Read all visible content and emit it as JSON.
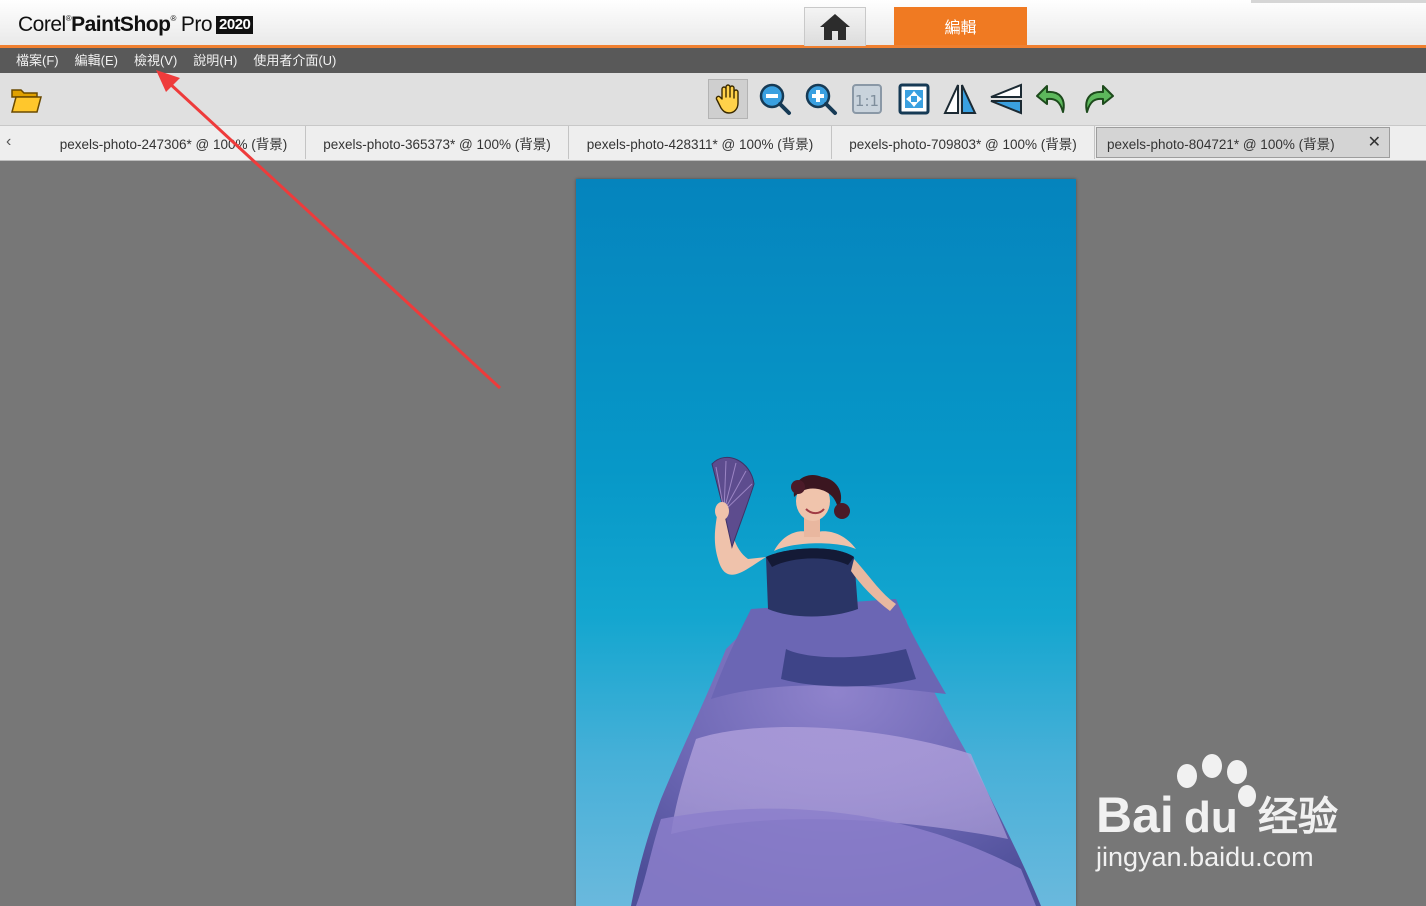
{
  "app": {
    "brand_corel": "Corel",
    "brand_paintshop": "PaintShop",
    "brand_pro": "Pro",
    "brand_year": "2020",
    "reg_mark": "®"
  },
  "workspace_tabs": {
    "home_icon": "home-icon",
    "edit_label": "編輯"
  },
  "menu": [
    {
      "label": "檔案(F)"
    },
    {
      "label": "編輯(E)"
    },
    {
      "label": "檢視(V)"
    },
    {
      "label": "說明(H)"
    },
    {
      "label": "使用者介面(U)"
    }
  ],
  "toolbar": {
    "open_icon": "folder-open-icon",
    "tools": [
      "pan-hand-icon",
      "zoom-out-icon",
      "zoom-in-icon",
      "actual-size-icon",
      "fit-window-icon",
      "flip-horizontal-icon",
      "flip-vertical-icon",
      "undo-icon",
      "redo-icon"
    ],
    "actual_size_label": "1:1"
  },
  "doc_tabs": {
    "scroll_left": "‹",
    "close": "✕",
    "items": [
      {
        "label": "pexels-photo-247306* @ 100% (背景)"
      },
      {
        "label": "pexels-photo-365373* @ 100% (背景)"
      },
      {
        "label": "pexels-photo-428311* @ 100% (背景)"
      },
      {
        "label": "pexels-photo-709803* @ 100% (背景)"
      },
      {
        "label": "pexels-photo-804721* @ 100% (背景)",
        "active": true
      }
    ]
  },
  "watermark": {
    "brand": "Bai",
    "brand_du": "du",
    "brand_cn": "经验",
    "url": "jingyan.baidu.com"
  },
  "colors": {
    "accent": "#f07a22",
    "menubar": "#595959",
    "workspace": "#777777",
    "annotation_arrow": "#ee3b3b"
  }
}
